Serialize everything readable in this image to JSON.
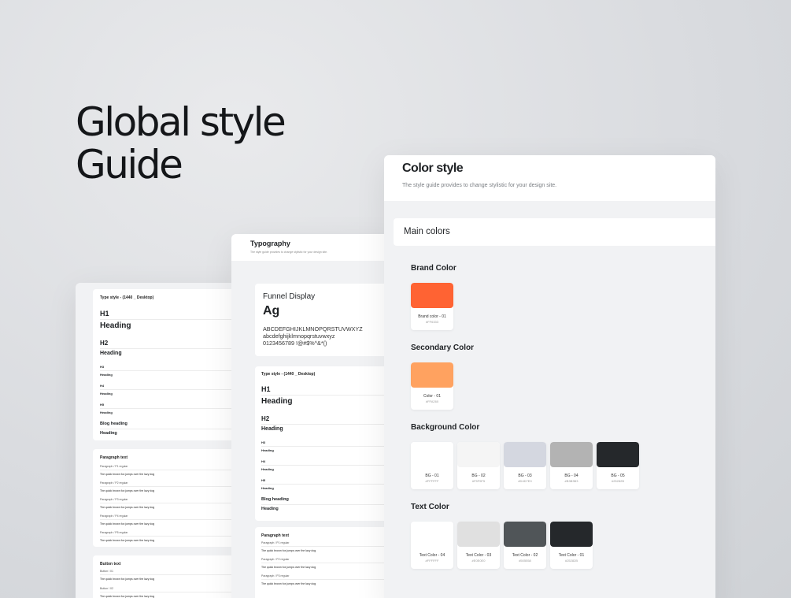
{
  "hero": {
    "line1": "Global style",
    "line2": "Guide"
  },
  "left_panel": {
    "type_card": {
      "title": "Type style - (1440 _ Desktop)",
      "rows": [
        {
          "label": "H1",
          "sample": "Heading"
        },
        {
          "label": "H2",
          "sample": "Heading"
        },
        {
          "label": "H3",
          "sample": "Heading"
        },
        {
          "label": "H4",
          "sample": "Heading"
        },
        {
          "label": "H5",
          "sample": "Heading"
        },
        {
          "label": "Blog heading",
          "sample": "Heading"
        }
      ]
    },
    "paragraph_card": {
      "title": "Paragraph text",
      "rows": [
        {
          "label": "Paragraph / P1 regular",
          "sample": "The quick brown fox jumps over the lazy dog"
        },
        {
          "label": "Paragraph / P2 regular",
          "sample": "The quick brown fox jumps over the lazy dog"
        },
        {
          "label": "Paragraph / P3 regular",
          "sample": "The quick brown fox jumps over the lazy dog"
        },
        {
          "label": "Paragraph / P4 regular",
          "sample": "The quick brown fox jumps over the lazy dog"
        },
        {
          "label": "Paragraph / P5 regular",
          "sample": "The quick brown fox jumps over the lazy dog"
        }
      ]
    },
    "button_card": {
      "title": "Button text",
      "rows": [
        {
          "label": "Button / 01",
          "sample": "The quick brown fox jumps over the lazy dog"
        },
        {
          "label": "Button / 02",
          "sample": "The quick brown fox jumps over the lazy dog"
        }
      ]
    }
  },
  "mid_panel": {
    "title": "Typography",
    "subtitle": "The style guide provides to change stylistic for your design site.",
    "font_card": {
      "font_name": "Funnel Display",
      "sample": "Ag",
      "upper": "ABCDEFGHIJKLMNOPQRSTUVWXYZ",
      "lower": "abcdefghijklmnopqrstuvwxyz",
      "digits": "0123456789 !@#$%^&*()"
    },
    "type_card": {
      "title": "Type style - (1440 _ Desktop)",
      "rows": [
        {
          "label": "H1",
          "sample": "Heading"
        },
        {
          "label": "H2",
          "sample": "Heading"
        },
        {
          "label": "H3",
          "sample": "Heading"
        },
        {
          "label": "H4",
          "sample": "Heading"
        },
        {
          "label": "H5",
          "sample": "Heading"
        },
        {
          "label": "Blog heading",
          "sample": "Heading"
        }
      ]
    },
    "paragraph_card": {
      "title": "Paragraph text",
      "rows": [
        {
          "label": "Paragraph / P1 regular",
          "sample": "The quick brown fox jumps over the lazy dog"
        },
        {
          "label": "Paragraph / P2 regular",
          "sample": "The quick brown fox jumps over the lazy dog"
        },
        {
          "label": "Paragraph / P3 regular",
          "sample": "The quick brown fox jumps over the lazy dog"
        }
      ]
    }
  },
  "right_panel": {
    "title": "Color style",
    "subtitle": "The style guide provides to change stylistic for your design site.",
    "main_heading": "Main colors",
    "brand": {
      "title": "Brand Color",
      "swatches": [
        {
          "name": "Brand color - 01",
          "hex": "#FF6333",
          "color": "#FF6333"
        }
      ]
    },
    "secondary": {
      "title": "Secondary Color",
      "swatches": [
        {
          "name": "Color - 01",
          "hex": "#FFA260",
          "color": "#FFA260"
        }
      ]
    },
    "background": {
      "title": "Background Color",
      "swatches": [
        {
          "name": "BG - 01",
          "hex": "#FFFFFF",
          "color": "#FFFFFF"
        },
        {
          "name": "BG - 02",
          "hex": "#F5F5F5",
          "color": "#F5F5F5"
        },
        {
          "name": "BG - 03",
          "hex": "#D4D7E0",
          "color": "#D4D7E0"
        },
        {
          "name": "BG - 04",
          "hex": "#B3B3B3",
          "color": "#B3B3B3"
        },
        {
          "name": "BG - 05",
          "hex": "#25282B",
          "color": "#25282B"
        }
      ]
    },
    "text": {
      "title": "Text Color",
      "swatches": [
        {
          "name": "Text Color - 04",
          "hex": "#FFFFFF",
          "color": "#FFFFFF"
        },
        {
          "name": "Text Color - 03",
          "hex": "#E0E0E0",
          "color": "#E0E0E0"
        },
        {
          "name": "Text Color - 02",
          "hex": "#505558",
          "color": "#505558"
        },
        {
          "name": "Text Color - 01",
          "hex": "#25282B",
          "color": "#25282B"
        }
      ]
    }
  }
}
